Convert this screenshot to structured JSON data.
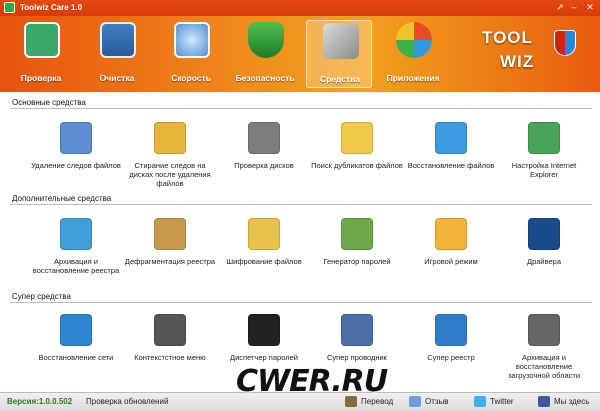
{
  "window": {
    "title": "Toolwiz Care 1.0"
  },
  "toolbar": {
    "items": [
      {
        "label": "Проверка",
        "icon": "health-check-icon"
      },
      {
        "label": "Очистка",
        "icon": "cleanup-icon"
      },
      {
        "label": "Скорость",
        "icon": "speed-gauge-icon"
      },
      {
        "label": "Безопасность",
        "icon": "security-shield-icon"
      },
      {
        "label": "Средства",
        "icon": "tools-icon",
        "active": true
      },
      {
        "label": "Приложения",
        "icon": "apps-icon"
      }
    ],
    "logo": {
      "line1": "TOOL",
      "line2": "WIZ"
    }
  },
  "sections": [
    {
      "title": "Основные средства",
      "items": [
        {
          "label": "Удаление следов файлов",
          "icon": "file-shredder-icon",
          "color": "#5b8fd1"
        },
        {
          "label": "Стирание следов на дисках после удаления файлов",
          "icon": "disk-wipe-icon",
          "color": "#e8b43a"
        },
        {
          "label": "Проверка дисков",
          "icon": "disk-check-icon",
          "color": "#7d7d7d"
        },
        {
          "label": "Поиск дубликатов файлов",
          "icon": "duplicate-files-icon",
          "color": "#f2c94c"
        },
        {
          "label": "Восстановление файлов",
          "icon": "file-recovery-icon",
          "color": "#3d9be0"
        },
        {
          "label": "Настройка Internet Explorer",
          "icon": "ie-settings-icon",
          "color": "#49a45a"
        }
      ]
    },
    {
      "title": "Дополнительные средства",
      "items": [
        {
          "label": "Архивация и восстановление реестра",
          "icon": "registry-backup-icon",
          "color": "#3fa0d8"
        },
        {
          "label": "Дефрагментация реестра",
          "icon": "registry-defrag-icon",
          "color": "#c79a4a"
        },
        {
          "label": "Шифрование файлов",
          "icon": "file-encryption-icon",
          "color": "#e8c24a"
        },
        {
          "label": "Генератор паролей",
          "icon": "password-generator-icon",
          "color": "#6fa84a"
        },
        {
          "label": "Игровой режим",
          "icon": "game-mode-icon",
          "color": "#f0b536"
        },
        {
          "label": "Драйвера",
          "icon": "drivers-icon",
          "color": "#1a4a8a"
        }
      ]
    },
    {
      "title": "Супер средства",
      "items": [
        {
          "label": "Восстановление сети",
          "icon": "network-repair-icon",
          "color": "#2e86d0"
        },
        {
          "label": "Контекстстное меню",
          "icon": "context-menu-icon",
          "color": "#555555"
        },
        {
          "label": "Диспетчер паролей",
          "icon": "password-manager-icon",
          "color": "#222222"
        },
        {
          "label": "Супер проводник",
          "icon": "super-explorer-icon",
          "color": "#4a6ea8"
        },
        {
          "label": "Супер реестр",
          "icon": "super-registry-icon",
          "color": "#2f7fc8"
        },
        {
          "label": "Архивация и восстановление загрузочной области",
          "icon": "boot-backup-icon",
          "color": "#666666"
        }
      ]
    }
  ],
  "status": {
    "version": "Версия:1.0.0.502",
    "update": "Проверка обновлений",
    "translate": "Перевод",
    "feedback": "Отзыв",
    "twitter": "Twitter",
    "facebook": "Мы здесь"
  },
  "watermark": "CWER.RU"
}
